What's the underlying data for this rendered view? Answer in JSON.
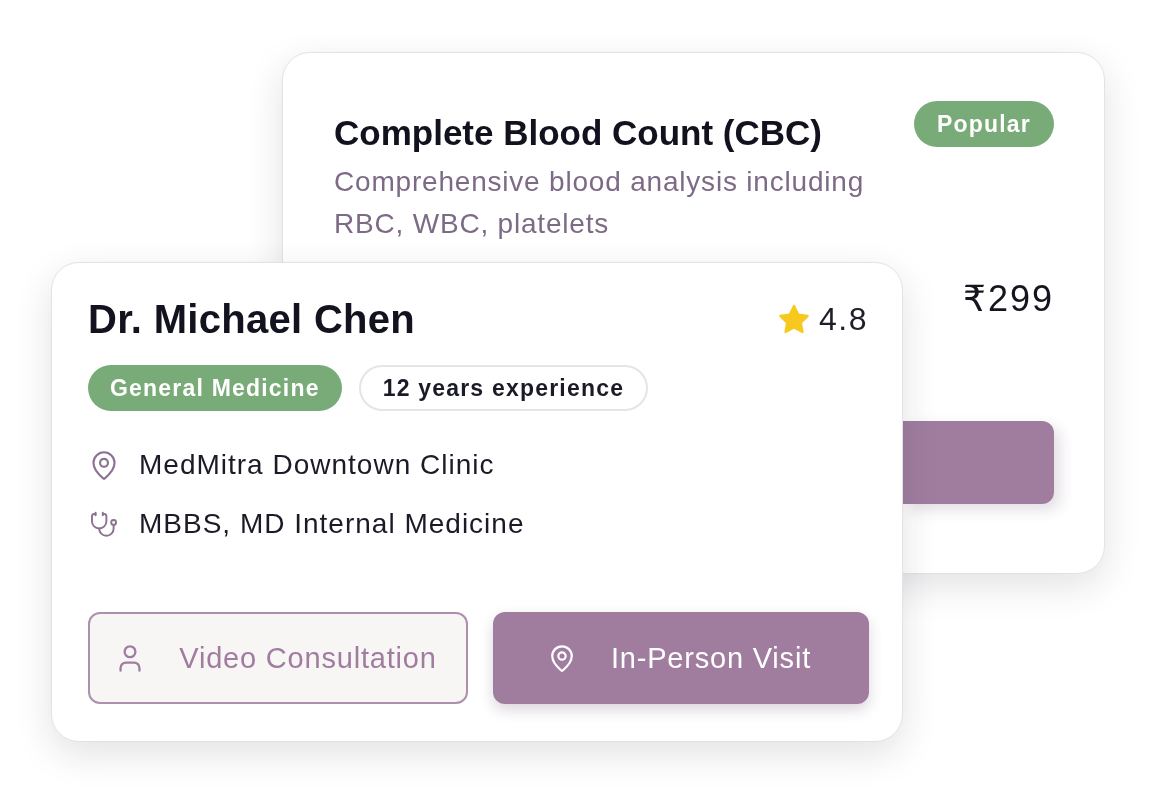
{
  "test_card": {
    "title": "Complete Blood Count (CBC)",
    "badge": "Popular",
    "description": "Comprehensive blood analysis including RBC, WBC, platelets",
    "price": "₹299"
  },
  "doctor_card": {
    "name": "Dr. Michael Chen",
    "rating": "4.8",
    "tags": [
      {
        "label": "General Medicine",
        "kind": "filled"
      },
      {
        "label": "12 years experience",
        "kind": "outline"
      }
    ],
    "details": [
      {
        "kind": "location",
        "text": "MedMitra Downtown Clinic"
      },
      {
        "kind": "qualification",
        "text": "MBBS, MD Internal Medicine"
      }
    ],
    "buttons": [
      {
        "label": "Video Consultation",
        "kind": "outline"
      },
      {
        "label": "In-Person Visit",
        "kind": "filled"
      }
    ]
  }
}
